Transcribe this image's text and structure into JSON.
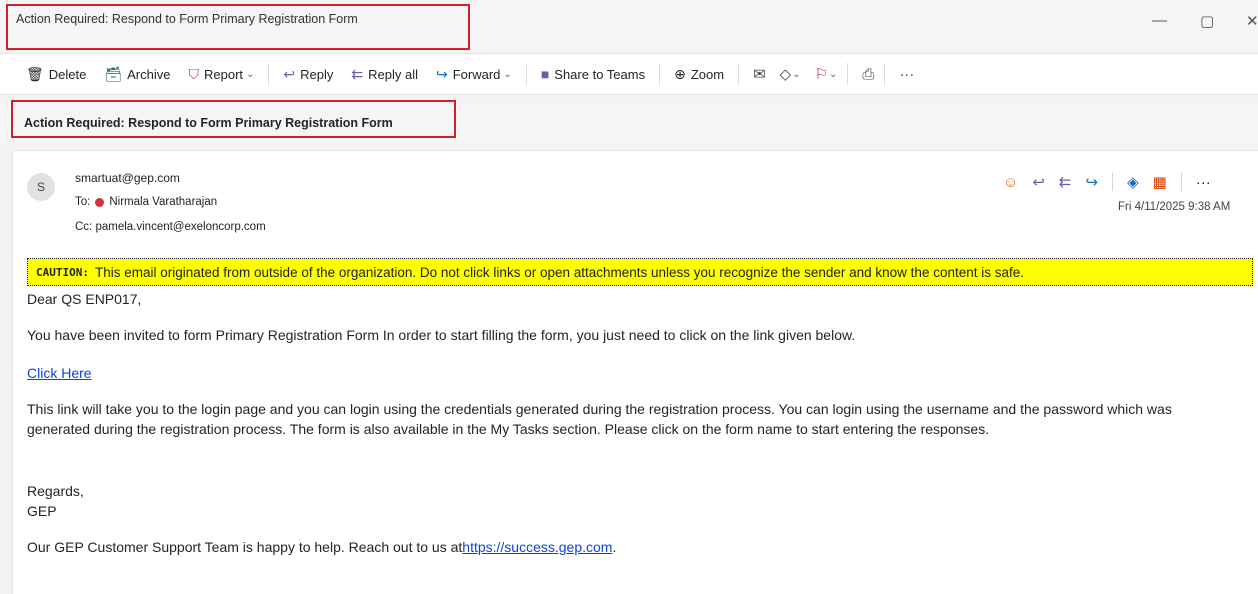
{
  "window": {
    "title": "Action Required: Respond to Form Primary Registration Form",
    "minimize": "—",
    "restore": "▢",
    "close": "✕"
  },
  "toolbar": {
    "delete": "Delete",
    "archive": "Archive",
    "report": "Report",
    "reply": "Reply",
    "reply_all": "Reply all",
    "forward": "Forward",
    "share_teams": "Share to Teams",
    "zoom": "Zoom",
    "more": "···"
  },
  "subject": "Action Required: Respond to Form Primary Registration Form",
  "message": {
    "avatar_initial": "S",
    "from": "smartuat@gep.com",
    "to_label": "To:",
    "to_name": "Nirmala Varatharajan",
    "cc_label": "Cc:",
    "cc": "pamela.vincent@exeloncorp.com",
    "date": "Fri 4/11/2025 9:38 AM",
    "more": "···"
  },
  "caution": {
    "label": "CAUTION:",
    "text": "This email originated from outside of the organization. Do not click links or open attachments unless you recognize the sender and know the content is safe."
  },
  "body": {
    "greeting": "Dear QS ENP017,",
    "intro": "You have been invited to form Primary Registration Form In order to start filling the form, you just need to click on the link given below.",
    "link": "Click Here",
    "para2": "This link will take you to the login page and you can login using the credentials generated during the registration process. You can login using the username and the password which was generated during the registration process. The form is also available in the My Tasks section. Please click on the form name to start entering the responses.",
    "regards": "Regards,",
    "signature": "GEP",
    "support_prefix": "Our GEP Customer Support Team is happy to help. Reach out to us at",
    "support_link": "https://success.gep.com",
    "support_suffix": "."
  },
  "colors": {
    "highlight_box": "#d0212a",
    "caution_bg": "#ffff00",
    "link": "#0b45d8"
  }
}
